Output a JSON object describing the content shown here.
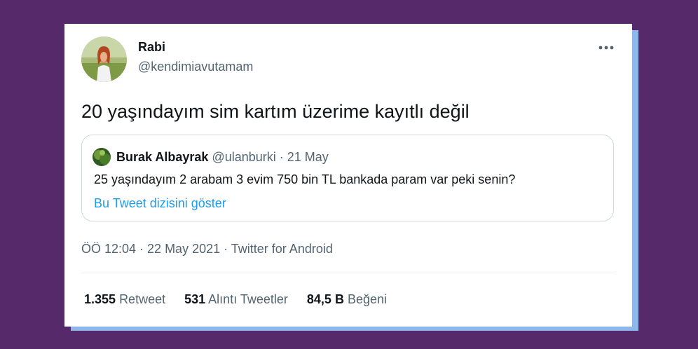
{
  "tweet": {
    "author_name": "Rabi",
    "author_handle": "@kendimiavutamam",
    "more_icon": "more-horizontal-icon",
    "text": "20 yaşındayım sim kartım üzerime kayıtlı değil",
    "timestamp": "ÖÖ 12:04 · 22 May 2021 · Twitter for Android"
  },
  "quote": {
    "author_name": "Burak Albayrak",
    "meta": "@ulanburki · 21 May",
    "text": "25 yaşındayım 2 arabam 3 evim 750 bin TL bankada param var peki senin?",
    "link": "Bu Tweet dizisini göster"
  },
  "stats": {
    "retweets_count": "1.355",
    "retweets_label": "Retweet",
    "quotes_count": "531",
    "quotes_label": "Alıntı Tweetler",
    "likes_count": "84,5 B",
    "likes_label": "Beğeni"
  },
  "colors": {
    "background": "#55296a",
    "card_shadow": "#8db6ea",
    "link": "#1d9bf0",
    "text_primary": "#0f1419",
    "text_secondary": "#536471"
  }
}
